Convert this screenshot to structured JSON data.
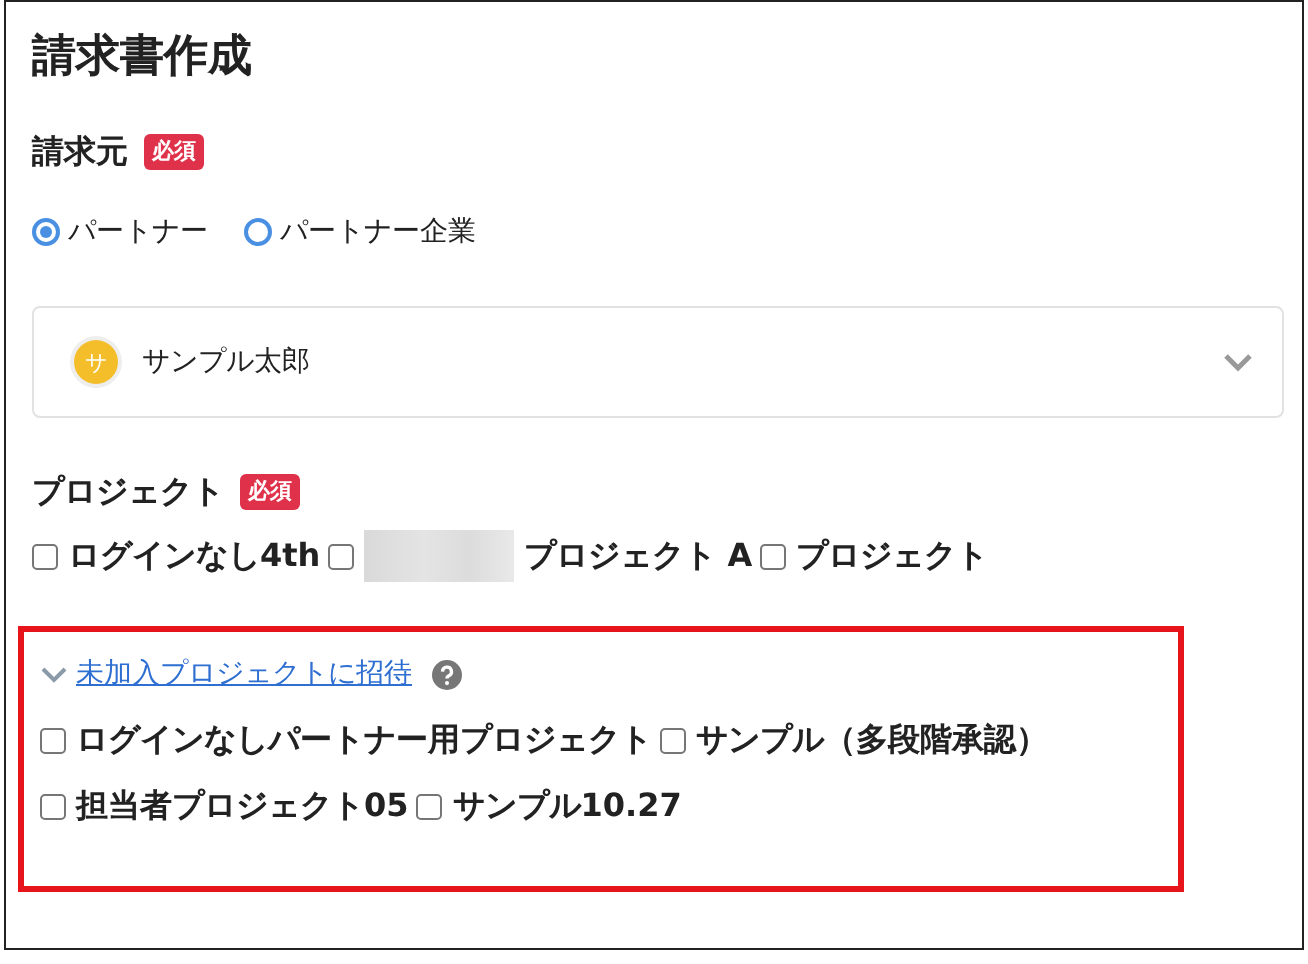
{
  "title": "請求書作成",
  "billing_from": {
    "label": "請求元",
    "badge": "必須",
    "options": [
      {
        "label": "パートナー",
        "selected": true
      },
      {
        "label": "パートナー企業",
        "selected": false
      }
    ],
    "select": {
      "avatar": "サ",
      "value": "サンプル太郎"
    }
  },
  "project": {
    "label": "プロジェクト",
    "badge": "必須",
    "items": [
      {
        "label": "ログインなし4th",
        "checked": false,
        "redacted": false
      },
      {
        "label": "プロジェクト A",
        "checked": false,
        "redacted": true
      },
      {
        "label": "プロジェクト",
        "checked": false,
        "redacted": false
      }
    ]
  },
  "invite": {
    "link": "未加入プロジェクトに招待",
    "items": [
      {
        "label": "ログインなしパートナー用プロジェクト",
        "checked": false
      },
      {
        "label": "サンプル（多段階承認）",
        "checked": false
      },
      {
        "label": "担当者プロジェクト05",
        "checked": false
      },
      {
        "label": "サンプル10.27",
        "checked": false
      }
    ]
  }
}
